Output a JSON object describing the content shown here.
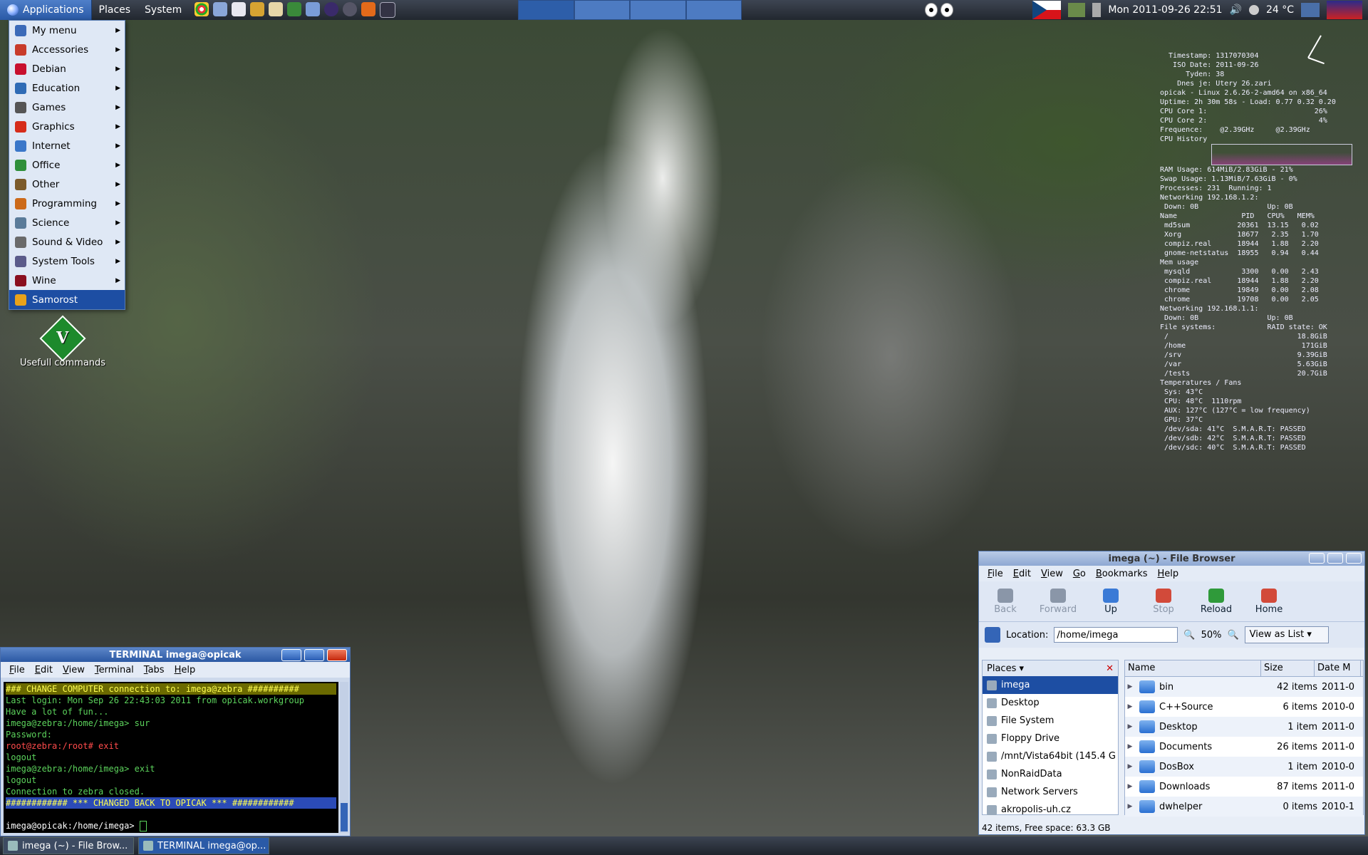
{
  "top_panel": {
    "menus": [
      "Applications",
      "Places",
      "System"
    ],
    "datetime": "Mon 2011-09-26 22:51",
    "temperature": "24 °C"
  },
  "app_menu": {
    "items": [
      {
        "label": "My menu",
        "icon_color": "#3b6ab8"
      },
      {
        "label": "Accessories",
        "icon_color": "#c83b2a"
      },
      {
        "label": "Debian",
        "icon_color": "#c8102e"
      },
      {
        "label": "Education",
        "icon_color": "#2f6bb5"
      },
      {
        "label": "Games",
        "icon_color": "#555555"
      },
      {
        "label": "Graphics",
        "icon_color": "#d62c1a"
      },
      {
        "label": "Internet",
        "icon_color": "#3a77c9"
      },
      {
        "label": "Office",
        "icon_color": "#2f8f3a"
      },
      {
        "label": "Other",
        "icon_color": "#7b5a2a"
      },
      {
        "label": "Programming",
        "icon_color": "#cc6a1a"
      },
      {
        "label": "Science",
        "icon_color": "#5a7b99"
      },
      {
        "label": "Sound & Video",
        "icon_color": "#6a6a6a"
      },
      {
        "label": "System Tools",
        "icon_color": "#5b5b8a"
      },
      {
        "label": "Wine",
        "icon_color": "#8a0f1f"
      },
      {
        "label": "Samorost",
        "icon_color": "#e8a21a"
      }
    ],
    "selected": "Samorost"
  },
  "desktop_icon": {
    "label": "Usefull commands",
    "glyph": "V"
  },
  "conky": {
    "rows": [
      "  Timestamp: 1317070304",
      "   ISO Date: 2011-09-26",
      "      Tyden: 38",
      "    Dnes je: Utery 26.zari",
      "opicak - Linux 2.6.26-2-amd64 on x86_64",
      "",
      "Uptime: 2h 30m 58s - Load: 0.77 0.32 0.20",
      "CPU Core 1:                         26%",
      "CPU Core 2:                          4%",
      "Frequence:    @2.39GHz     @2.39GHz",
      "CPU History",
      "RAM Usage: 614MiB/2.83GiB - 21%",
      "Swap Usage: 1.13MiB/7.63GiB - 0%",
      "Processes: 231  Running: 1",
      "",
      "Networking 192.168.1.2:",
      " Down: 0B                Up: 0B",
      "",
      "Name               PID   CPU%   MEM%",
      " md5sum           20361  13.15   0.02",
      " Xorg             18677   2.35   1.70",
      " compiz.real      18944   1.88   2.20",
      " gnome-netstatus  18955   0.94   0.44",
      "Mem usage",
      " mysqld            3300   0.00   2.43",
      " compiz.real      18944   1.88   2.20",
      " chrome           19849   0.00   2.08",
      " chrome           19708   0.00   2.05",
      "Networking 192.168.1.1:",
      " Down: 0B                Up: 0B",
      "",
      "",
      "File systems:            RAID state: OK",
      " /                              18.8GiB",
      " /home                           171GiB",
      " /srv                           9.39GiB",
      " /var                           5.63GiB",
      " /tests                         20.7GiB",
      "Temperatures / Fans",
      " Sys: 43°C",
      " CPU: 48°C  1110rpm",
      " AUX: 127°C (127°C = low frequency)",
      " GPU: 37°C",
      " /dev/sda: 41°C  S.M.A.R.T: PASSED",
      " /dev/sdb: 42°C  S.M.A.R.T: PASSED",
      " /dev/sdc: 40°C  S.M.A.R.T: PASSED"
    ]
  },
  "terminal": {
    "title": "TERMINAL imega@opicak",
    "menus": [
      "File",
      "Edit",
      "View",
      "Terminal",
      "Tabs",
      "Help"
    ],
    "lines": [
      {
        "text": "### CHANGE COMPUTER connection to: imega@zebra ##########",
        "style": "hl"
      },
      {
        "text": "Last login: Mon Sep 26 22:43:03 2011 from opicak.workgroup",
        "style": ""
      },
      {
        "text": "Have a lot of fun...",
        "style": ""
      },
      {
        "text": "imega@zebra:/home/imega> sur",
        "style": ""
      },
      {
        "text": "Password:",
        "style": ""
      },
      {
        "text": "root@zebra:/root# exit",
        "style": "red"
      },
      {
        "text": "logout",
        "style": ""
      },
      {
        "text": "imega@zebra:/home/imega> exit",
        "style": ""
      },
      {
        "text": "logout",
        "style": ""
      },
      {
        "text": "Connection to zebra closed.",
        "style": ""
      },
      {
        "text": "############ *** CHANGED BACK TO OPICAK *** ############",
        "style": "hl2"
      },
      {
        "text": "",
        "style": ""
      },
      {
        "text": "imega@opicak:/home/imega> ",
        "style": "wh"
      }
    ]
  },
  "file_browser": {
    "title": "imega (~) - File Browser",
    "menus": [
      "File",
      "Edit",
      "View",
      "Go",
      "Bookmarks",
      "Help"
    ],
    "tools": [
      {
        "label": "Back",
        "disabled": true
      },
      {
        "label": "Forward",
        "disabled": true
      },
      {
        "label": "Up",
        "disabled": false
      },
      {
        "label": "Stop",
        "disabled": true
      },
      {
        "label": "Reload",
        "disabled": false
      },
      {
        "label": "Home",
        "disabled": false
      }
    ],
    "location_label": "Location:",
    "location": "/home/imega",
    "zoom": "50%",
    "view_mode": "View as List",
    "places_header": "Places",
    "places": [
      "imega",
      "Desktop",
      "File System",
      "Floppy Drive",
      "/mnt/Vista64bit (145.4 G",
      "NonRaidData",
      "Network Servers",
      "akropolis-uh.cz"
    ],
    "columns": [
      "Name",
      "Size",
      "Date M"
    ],
    "files": [
      {
        "name": "bin",
        "size": "42 items",
        "date": "2011-0"
      },
      {
        "name": "C++Source",
        "size": "6 items",
        "date": "2010-0"
      },
      {
        "name": "Desktop",
        "size": "1 item",
        "date": "2011-0"
      },
      {
        "name": "Documents",
        "size": "26 items",
        "date": "2011-0"
      },
      {
        "name": "DosBox",
        "size": "1 item",
        "date": "2010-0"
      },
      {
        "name": "Downloads",
        "size": "87 items",
        "date": "2011-0"
      },
      {
        "name": "dwhelper",
        "size": "0 items",
        "date": "2010-1"
      }
    ],
    "status": "42 items, Free space: 63.3 GB"
  },
  "taskbar": {
    "tasks": [
      {
        "label": "imega (~) - File Brow...",
        "active": false
      },
      {
        "label": "TERMINAL imega@op...",
        "active": true
      }
    ]
  }
}
